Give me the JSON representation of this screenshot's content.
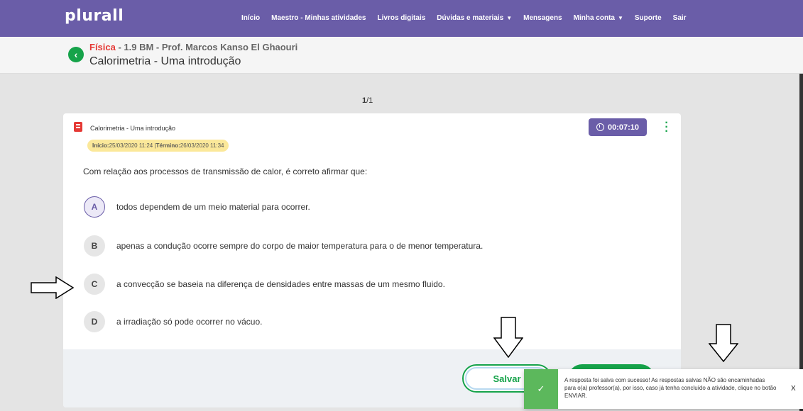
{
  "brand": {
    "logo": "plurall"
  },
  "nav": {
    "items": [
      {
        "label": "Início",
        "dropdown": false
      },
      {
        "label": "Maestro - Minhas atividades",
        "dropdown": false
      },
      {
        "label": "Livros digitais",
        "dropdown": false
      },
      {
        "label": "Dúvidas e materiais",
        "dropdown": true
      },
      {
        "label": "Mensagens",
        "dropdown": false
      },
      {
        "label": "Minha conta",
        "dropdown": true
      },
      {
        "label": "Suporte",
        "dropdown": false
      },
      {
        "label": "Sair",
        "dropdown": false
      }
    ]
  },
  "header": {
    "subject": "Física",
    "course_detail": " - 1.9 BM - Prof. Marcos Kanso El Ghaouri",
    "title": "Calorimetria - Uma introdução"
  },
  "pager": {
    "current": "1",
    "total": "/1"
  },
  "activity": {
    "name": "Calorimetria - Uma introdução",
    "start_label": "Início:",
    "start_value": " 25/03/2020 11:24 | ",
    "end_label": "Término:",
    "end_value": " 26/03/2020 11:34",
    "timer": "00:07:10"
  },
  "question": {
    "text": "Com relação aos processos de transmissão de calor, é correto afirmar que:",
    "options": [
      {
        "letter": "A",
        "text": "todos dependem de um meio material para ocorrer.",
        "selected": true
      },
      {
        "letter": "B",
        "text": "apenas a condução ocorre sempre do corpo de maior temperatura para o de menor temperatura.",
        "selected": false
      },
      {
        "letter": "C",
        "text": "a convecção se baseia na diferença de densidades entre massas de um mesmo fluido.",
        "selected": false
      },
      {
        "letter": "D",
        "text": "a irradiação só pode ocorrer no vácuo.",
        "selected": false
      }
    ]
  },
  "actions": {
    "save_label": "Salvar"
  },
  "toast": {
    "message": "A resposta foi salva com sucesso! As respostas salvas NÃO são encaminhadas para o(a) professor(a), por isso, caso já tenha concluído a atividade, clique no botão ENVIAR.",
    "close_label": "X",
    "check_glyph": "✓"
  },
  "colors": {
    "brand_purple": "#6a5da8",
    "accent_green": "#16a34a",
    "subject_red": "#e53935",
    "toast_green": "#5cb85c",
    "badge_yellow": "#fbe89a"
  }
}
